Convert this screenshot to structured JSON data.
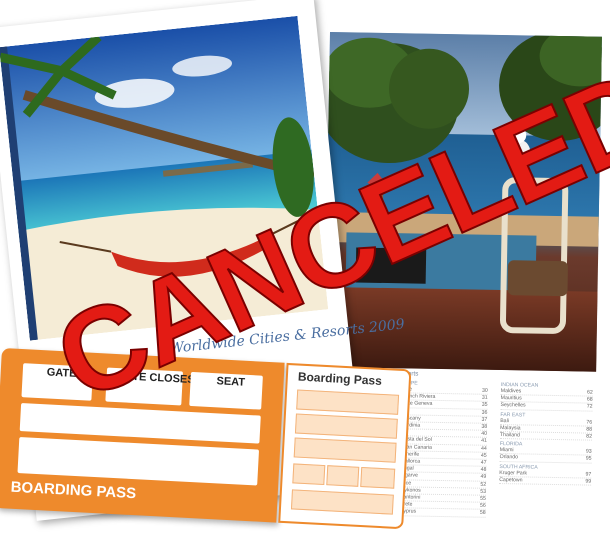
{
  "brochure": {
    "cover_title": "Worldwide Cities & Resorts 2009",
    "resorts_heading": "Resorts",
    "left_column": [
      {
        "type": "section",
        "name": "EUROPE"
      },
      {
        "type": "item",
        "name": "France",
        "page": "30"
      },
      {
        "type": "sub",
        "name": "French Riviera",
        "page": "31"
      },
      {
        "type": "sub",
        "name": "Lake Geneva",
        "page": "35"
      },
      {
        "type": "item",
        "name": "Italy",
        "page": "36"
      },
      {
        "type": "sub",
        "name": "Tuscany",
        "page": "37"
      },
      {
        "type": "sub",
        "name": "Sardinia",
        "page": "38"
      },
      {
        "type": "item",
        "name": "Spain",
        "page": "40"
      },
      {
        "type": "sub",
        "name": "Costa del Sol",
        "page": "41"
      },
      {
        "type": "sub",
        "name": "Gran Canaria",
        "page": "44"
      },
      {
        "type": "sub",
        "name": "Tenerife",
        "page": "45"
      },
      {
        "type": "sub",
        "name": "Mallorca",
        "page": "47"
      },
      {
        "type": "item",
        "name": "Portugal",
        "page": "48"
      },
      {
        "type": "sub",
        "name": "Algarve",
        "page": "49"
      },
      {
        "type": "item",
        "name": "Greece",
        "page": "52"
      },
      {
        "type": "sub",
        "name": "Mykonos",
        "page": "53"
      },
      {
        "type": "sub",
        "name": "Santorini",
        "page": "55"
      },
      {
        "type": "sub",
        "name": "Crete",
        "page": "56"
      },
      {
        "type": "sub",
        "name": "Cyprus",
        "page": "58"
      }
    ],
    "right_column": [
      {
        "type": "section",
        "name": "INDIAN OCEAN"
      },
      {
        "type": "item",
        "name": "Maldives",
        "page": "62"
      },
      {
        "type": "item",
        "name": "Mauritius",
        "page": "68"
      },
      {
        "type": "item",
        "name": "Seychelles",
        "page": "72"
      },
      {
        "type": "section",
        "name": "FAR EAST"
      },
      {
        "type": "item",
        "name": "Bali",
        "page": "76"
      },
      {
        "type": "item",
        "name": "Malaysia",
        "page": "88"
      },
      {
        "type": "item",
        "name": "Thailand",
        "page": "82"
      },
      {
        "type": "section",
        "name": "FLORIDA"
      },
      {
        "type": "item",
        "name": "Miami",
        "page": "93"
      },
      {
        "type": "item",
        "name": "Orlando",
        "page": "95"
      },
      {
        "type": "section",
        "name": "SOUTH AFRICA"
      },
      {
        "type": "item",
        "name": "Kruger Park",
        "page": "97"
      },
      {
        "type": "item",
        "name": "Capetown",
        "page": "99"
      }
    ],
    "left_margin_numbers": [
      "27",
      "28",
      "29",
      "23",
      "29",
      "34",
      "20",
      "18",
      "19",
      "11",
      "33",
      "11",
      "18",
      "18"
    ]
  },
  "boarding_pass": {
    "gate_label": "GATE",
    "gate_closes_label": "GATE CLOSES",
    "seat_label": "SEAT",
    "footer_label": "BOARDING PASS",
    "stub_title": "Boarding Pass"
  },
  "stamp": {
    "text": "CANCELED"
  },
  "colors": {
    "orange": "#ee8a2c",
    "stamp_red": "#e31b14"
  }
}
